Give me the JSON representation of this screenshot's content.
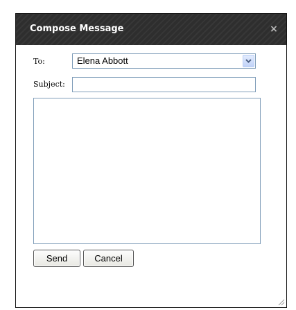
{
  "dialog": {
    "title": "Compose Message",
    "close_glyph": "×",
    "close_icon": "close-icon",
    "resize_icon": "resize-grip-icon"
  },
  "form": {
    "to_label": "To:",
    "to_value": "Elena Abbott",
    "dropdown_icon": "chevron-down-icon",
    "subject_label": "Subject:",
    "subject_value": "",
    "body_value": ""
  },
  "buttons": {
    "send_label": "Send",
    "cancel_label": "Cancel"
  },
  "colors": {
    "titlebar_background": "#2e2e2e",
    "title_text": "#ffffff",
    "input_border": "#7f9db9",
    "dropdown_button": "#c0d2f7"
  }
}
